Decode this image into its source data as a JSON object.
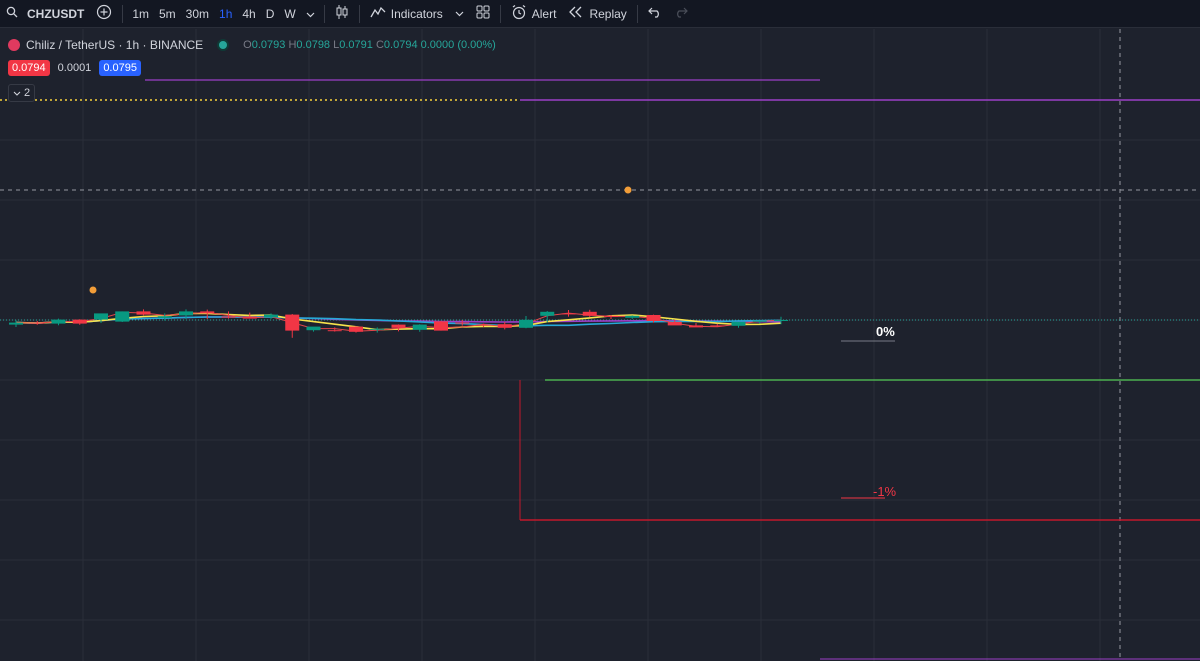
{
  "toolbar": {
    "symbol": "CHZUSDT",
    "timeframes": [
      "1m",
      "5m",
      "30m",
      "1h",
      "4h",
      "D",
      "W"
    ],
    "active_timeframe": "1h",
    "indicators_label": "Indicators",
    "alert_label": "Alert",
    "replay_label": "Replay"
  },
  "legend": {
    "title": "Chiliz / TetherUS · 1h · BINANCE",
    "o_label": "O",
    "o": "0.0793",
    "h_label": "H",
    "h": "0.0798",
    "l_label": "L",
    "l": "0.0791",
    "c_label": "C",
    "c": "0.0794 0.0000 (0.00%)"
  },
  "price_boxes": {
    "sell": "0.0794",
    "spread": "0.0001",
    "buy": "0.0795"
  },
  "collapse": {
    "count": "2"
  },
  "annotations": {
    "zero_pct": "0%",
    "minus_one_pct": "-1%"
  },
  "colors": {
    "up": "#089981",
    "down": "#f23645",
    "ma_fast": "#f7e34c",
    "ma_slow_red": "#e2454a",
    "ma_cyan": "#26a9d8",
    "ma_purple": "#9c3fc7",
    "green_line": "#4caf50",
    "red_line": "#c2182b"
  },
  "chart_data": {
    "type": "candlestick",
    "candles": [
      {
        "o": 0.07892,
        "h": 0.07914,
        "l": 0.0788,
        "c": 0.07902
      },
      {
        "o": 0.07902,
        "h": 0.0791,
        "l": 0.07891,
        "c": 0.07897
      },
      {
        "o": 0.07897,
        "h": 0.07922,
        "l": 0.07889,
        "c": 0.07917
      },
      {
        "o": 0.07917,
        "h": 0.07919,
        "l": 0.07891,
        "c": 0.07897
      },
      {
        "o": 0.07917,
        "h": 0.0793,
        "l": 0.079,
        "c": 0.07948
      },
      {
        "o": 0.07907,
        "h": 0.07958,
        "l": 0.07905,
        "c": 0.07958
      },
      {
        "o": 0.07958,
        "h": 0.07968,
        "l": 0.07938,
        "c": 0.07942
      },
      {
        "o": 0.07925,
        "h": 0.07948,
        "l": 0.07912,
        "c": 0.07934
      },
      {
        "o": 0.07938,
        "h": 0.07968,
        "l": 0.0792,
        "c": 0.07958
      },
      {
        "o": 0.07958,
        "h": 0.07967,
        "l": 0.0792,
        "c": 0.07948
      },
      {
        "o": 0.07932,
        "h": 0.07958,
        "l": 0.07922,
        "c": 0.07928
      },
      {
        "o": 0.07932,
        "h": 0.07952,
        "l": 0.07922,
        "c": 0.07922
      },
      {
        "o": 0.07928,
        "h": 0.07948,
        "l": 0.0792,
        "c": 0.07942
      },
      {
        "o": 0.07942,
        "h": 0.07945,
        "l": 0.07826,
        "c": 0.07862
      },
      {
        "o": 0.07864,
        "h": 0.07879,
        "l": 0.07857,
        "c": 0.07882
      },
      {
        "o": 0.07864,
        "h": 0.07878,
        "l": 0.07857,
        "c": 0.07862
      },
      {
        "o": 0.07882,
        "h": 0.07884,
        "l": 0.07852,
        "c": 0.07856
      },
      {
        "o": 0.07866,
        "h": 0.07878,
        "l": 0.07852,
        "c": 0.07871
      },
      {
        "o": 0.07892,
        "h": 0.07893,
        "l": 0.07858,
        "c": 0.07876
      },
      {
        "o": 0.07866,
        "h": 0.07894,
        "l": 0.07856,
        "c": 0.07892
      },
      {
        "o": 0.07908,
        "h": 0.0791,
        "l": 0.07862,
        "c": 0.07862
      },
      {
        "o": 0.07902,
        "h": 0.07915,
        "l": 0.07887,
        "c": 0.07898
      },
      {
        "o": 0.07892,
        "h": 0.07897,
        "l": 0.0788,
        "c": 0.07888
      },
      {
        "o": 0.07894,
        "h": 0.07906,
        "l": 0.07868,
        "c": 0.07876
      },
      {
        "o": 0.07876,
        "h": 0.07935,
        "l": 0.07874,
        "c": 0.07916
      },
      {
        "o": 0.07936,
        "h": 0.0796,
        "l": 0.07902,
        "c": 0.07956
      },
      {
        "o": 0.07948,
        "h": 0.07965,
        "l": 0.07932,
        "c": 0.07943
      },
      {
        "o": 0.07956,
        "h": 0.07966,
        "l": 0.0793,
        "c": 0.07936
      },
      {
        "o": 0.07936,
        "h": 0.0794,
        "l": 0.0792,
        "c": 0.0793
      },
      {
        "o": 0.07926,
        "h": 0.07938,
        "l": 0.0792,
        "c": 0.07936
      },
      {
        "o": 0.0794,
        "h": 0.07942,
        "l": 0.07902,
        "c": 0.0791
      },
      {
        "o": 0.07906,
        "h": 0.07916,
        "l": 0.07892,
        "c": 0.07888
      },
      {
        "o": 0.07888,
        "h": 0.079,
        "l": 0.0788,
        "c": 0.07878
      },
      {
        "o": 0.07888,
        "h": 0.07896,
        "l": 0.07882,
        "c": 0.07884
      },
      {
        "o": 0.07886,
        "h": 0.07904,
        "l": 0.07876,
        "c": 0.07906
      },
      {
        "o": 0.07906,
        "h": 0.07909,
        "l": 0.07898,
        "c": 0.07912
      },
      {
        "o": 0.0791,
        "h": 0.07931,
        "l": 0.07894,
        "c": 0.07915
      }
    ]
  }
}
